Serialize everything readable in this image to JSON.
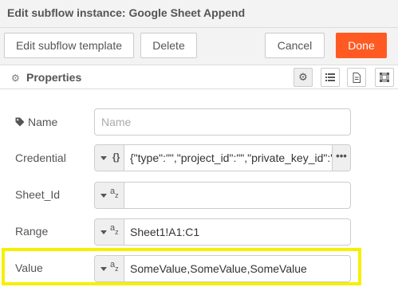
{
  "dialog": {
    "title": "Edit subflow instance: Google Sheet Append"
  },
  "buttons": {
    "edit_template": "Edit subflow template",
    "delete": "Delete",
    "cancel": "Cancel",
    "done": "Done"
  },
  "colors": {
    "primary": "#ff5a22",
    "highlight": "#f5f000"
  },
  "properties": {
    "title": "Properties",
    "tabs": [
      "gear-icon",
      "list-icon",
      "document-icon",
      "frame-icon"
    ]
  },
  "fields": {
    "name": {
      "label": "Name",
      "placeholder": "Name",
      "value": ""
    },
    "credential": {
      "label": "Credential",
      "type_icon": "{}",
      "value": "{\"type\":\"\",\"project_id\":\"\",\"private_key_id\":\"",
      "more": "•••"
    },
    "sheet_id": {
      "label": "Sheet_Id",
      "type_icon": "az",
      "value": ""
    },
    "range": {
      "label": "Range",
      "type_icon": "az",
      "value": "Sheet1!A1:C1"
    },
    "value": {
      "label": "Value",
      "type_icon": "az",
      "value": "SomeValue,SomeValue,SomeValue"
    }
  }
}
